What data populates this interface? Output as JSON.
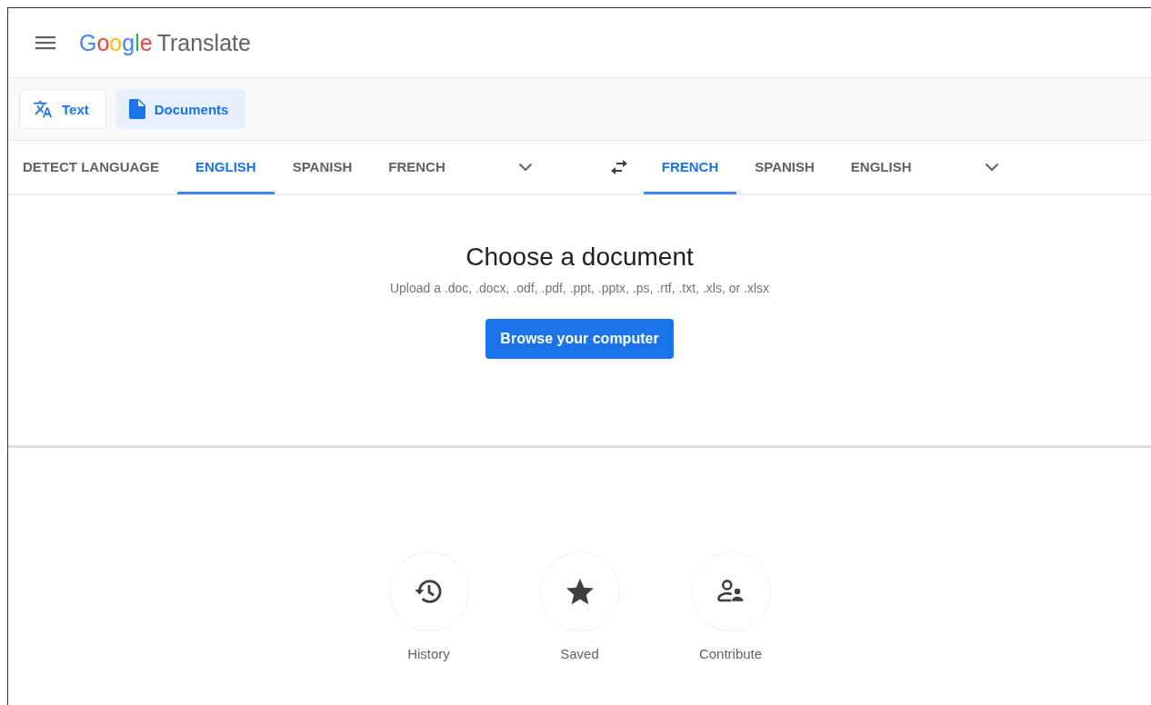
{
  "header": {
    "logo_word": "Google",
    "product": "Translate"
  },
  "modes": [
    {
      "label": "Text",
      "kind": "text",
      "selected": false
    },
    {
      "label": "Documents",
      "kind": "document",
      "selected": true
    }
  ],
  "source_languages": [
    {
      "label": "DETECT LANGUAGE",
      "selected": false
    },
    {
      "label": "ENGLISH",
      "selected": true
    },
    {
      "label": "SPANISH",
      "selected": false
    },
    {
      "label": "FRENCH",
      "selected": false
    }
  ],
  "target_languages": [
    {
      "label": "FRENCH",
      "selected": true
    },
    {
      "label": "SPANISH",
      "selected": false
    },
    {
      "label": "ENGLISH",
      "selected": false
    }
  ],
  "upload": {
    "title": "Choose a document",
    "hint": "Upload a .doc, .docx, .odf, .pdf, .ppt, .pptx, .ps, .rtf, .txt, .xls, or .xlsx",
    "button": "Browse your computer"
  },
  "shortcuts": [
    {
      "label": "History",
      "kind": "history"
    },
    {
      "label": "Saved",
      "kind": "saved"
    },
    {
      "label": "Contribute",
      "kind": "contribute"
    }
  ]
}
